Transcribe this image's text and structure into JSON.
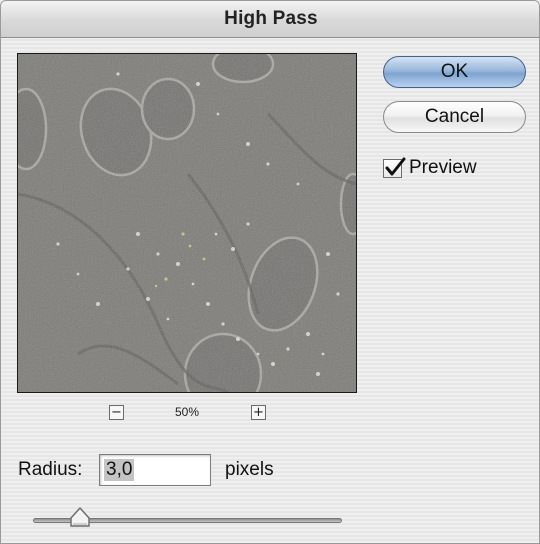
{
  "window": {
    "title": "High Pass"
  },
  "buttons": {
    "ok_label": "OK",
    "cancel_label": "Cancel"
  },
  "preview_option": {
    "label": "Preview",
    "checked": true
  },
  "zoom": {
    "level": "50%",
    "zoom_out_icon": "minus-icon",
    "zoom_in_icon": "plus-icon"
  },
  "radius": {
    "label": "Radius:",
    "value": "3,0",
    "units": "pixels"
  },
  "colors": {
    "ok_button": "#8fb1d9",
    "preview_background": "#7b7a76"
  }
}
